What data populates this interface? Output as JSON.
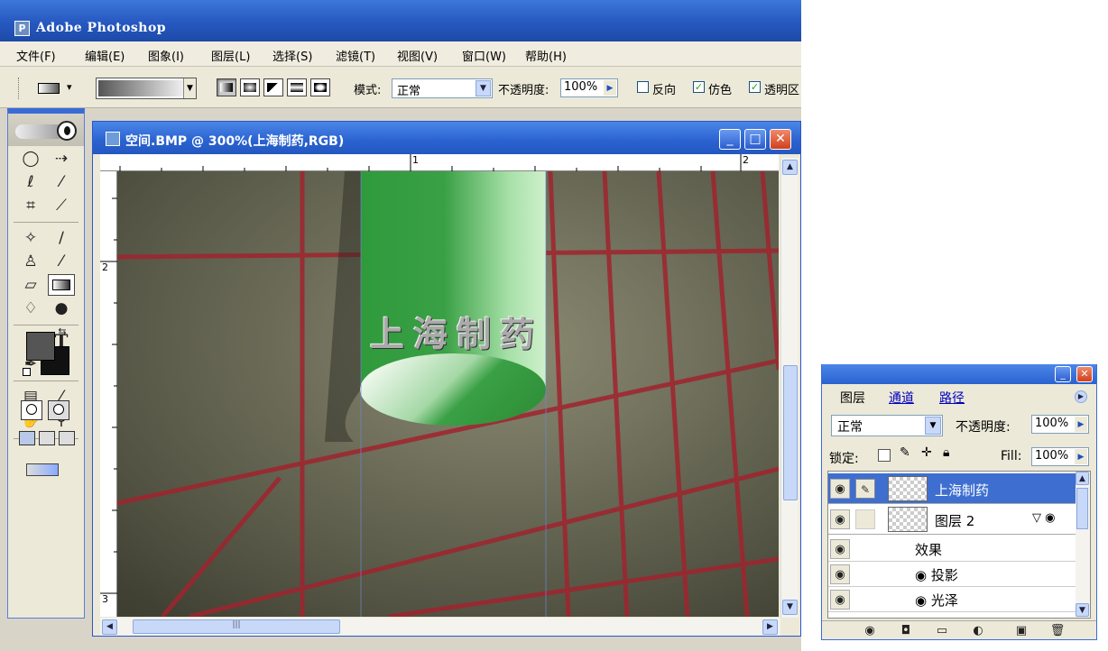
{
  "app": {
    "title": "Adobe Photoshop",
    "logo": "ps"
  },
  "menu": [
    "文件(F)",
    "编辑(E)",
    "图象(I)",
    "图层(L)",
    "选择(S)",
    "滤镜(T)",
    "视图(V)",
    "窗口(W)",
    "帮助(H)"
  ],
  "options": {
    "mode_label": "模式:",
    "mode_value": "正常",
    "opacity_label": "不透明度:",
    "opacity_value": "100%",
    "reverse_label": "反向",
    "dither_label": "仿色",
    "transparency_label": "透明区",
    "reverse_checked": false,
    "dither_checked": true,
    "transparency_checked": true,
    "gradient_types": [
      "linear",
      "radial",
      "angle",
      "reflected",
      "diamond"
    ]
  },
  "toolbox": {
    "tools": [
      "marquee",
      "move",
      "lasso",
      "magic-wand",
      "crop",
      "slice",
      "healing",
      "brush",
      "clone-stamp",
      "history-brush",
      "eraser",
      "gradient",
      "blur",
      "dodge",
      "path-select",
      "type",
      "pen",
      "line",
      "notes",
      "eyedropper",
      "hand",
      "zoom"
    ],
    "type_glyph": "T",
    "foreground": "#555555",
    "background": "#111111"
  },
  "document": {
    "title": "空间.BMP @ 300%(上海制药,RGB)",
    "ruler_top": [
      "1",
      "2"
    ],
    "ruler_left": [
      "2",
      "3"
    ],
    "cylinder_text": "上海制药",
    "colors": {
      "cylinder_green": "#3aa045",
      "grid_red": "#a0242e"
    }
  },
  "layers_panel": {
    "tabs": [
      "图层",
      "通道",
      "路径"
    ],
    "blend_mode": "正常",
    "opacity_label": "不透明度:",
    "opacity_value": "100%",
    "lock_label": "锁定:",
    "fill_label": "Fill:",
    "fill_value": "100%",
    "layers": [
      {
        "name": "上海制药",
        "selected": true
      },
      {
        "name": "图层 2",
        "selected": false,
        "has_effects": true
      }
    ],
    "effects_label": "效果",
    "effects": [
      "投影",
      "光泽"
    ]
  }
}
